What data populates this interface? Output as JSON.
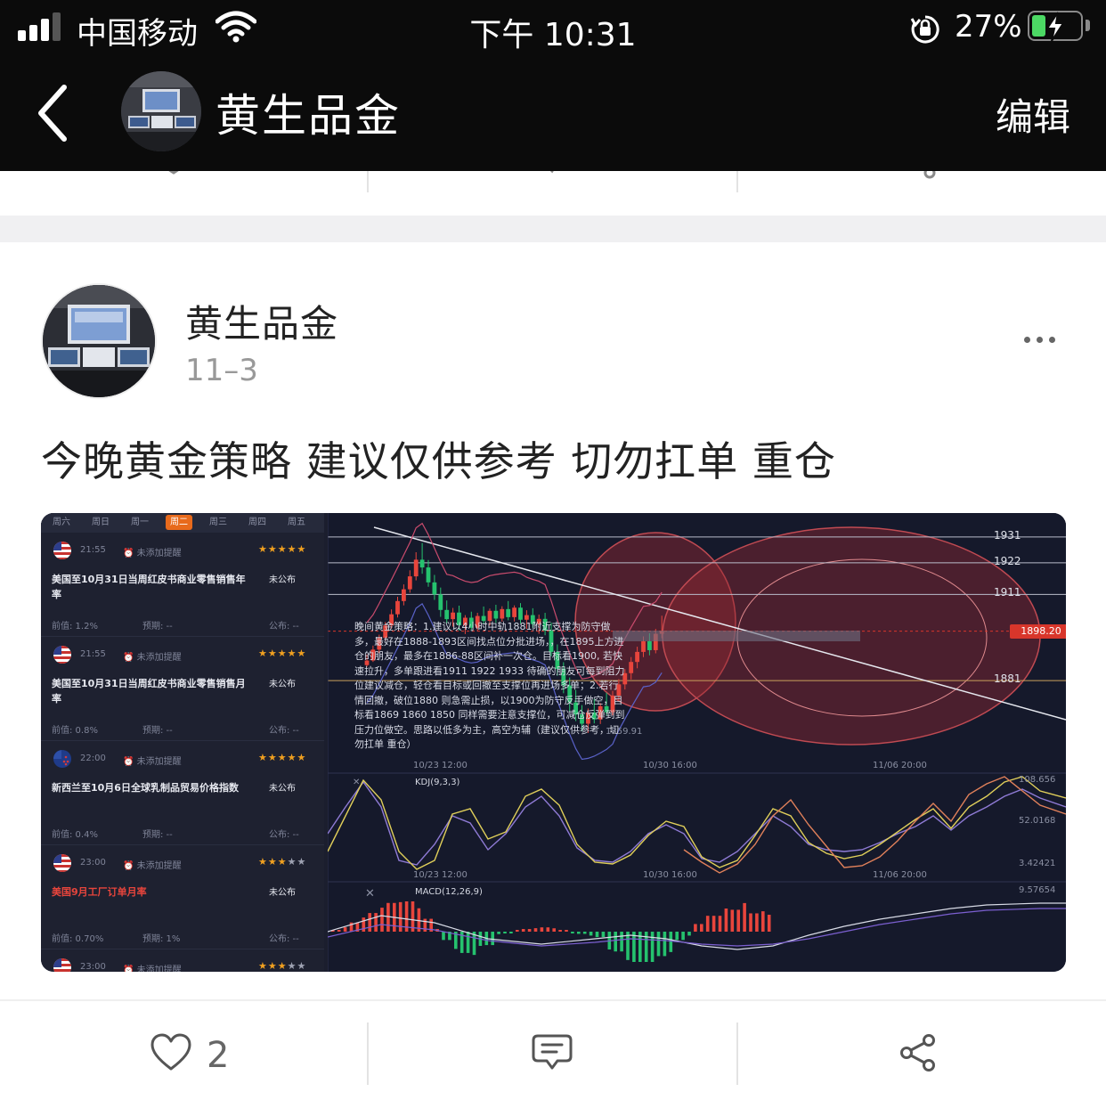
{
  "status_bar": {
    "carrier": "中国移动",
    "time": "下午 10:31",
    "battery_percent": "27%",
    "signal_bars": 3,
    "battery_level": 0.27,
    "battery_color": "#4cd964"
  },
  "navbar": {
    "title": "黄生品金",
    "edit_label": "编辑",
    "back_icon": "chevron-left-icon"
  },
  "post": {
    "author": "黄生品金",
    "date": "11–3",
    "text": "今晚黄金策略 建议仅供参考 切勿扛单 重仓",
    "more_icon": "more-dots-icon"
  },
  "image": {
    "weekday_tabs": [
      "周六",
      "周日",
      "周一",
      "周二",
      "周三",
      "周四",
      "周五"
    ],
    "active_tab": 3,
    "events": [
      {
        "time": "21:55",
        "reminder": "未添加提醒",
        "stars_on": 5,
        "title": "美国至10月31日当周红皮书商业零售销售年率",
        "status": "未公布",
        "prev": "前值: 1.2%",
        "forecast": "预期: --",
        "actual": "公布: --",
        "flag": "us",
        "highlight": false
      },
      {
        "time": "21:55",
        "reminder": "未添加提醒",
        "stars_on": 5,
        "title": "美国至10月31日当周红皮书商业零售销售月率",
        "status": "未公布",
        "prev": "前值: 0.8%",
        "forecast": "预期: --",
        "actual": "公布: --",
        "flag": "us",
        "highlight": false
      },
      {
        "time": "22:00",
        "reminder": "未添加提醒",
        "stars_on": 5,
        "title": "新西兰至10月6日全球乳制品贸易价格指数",
        "status": "未公布",
        "prev": "前值: 0.4%",
        "forecast": "预期: --",
        "actual": "公布: --",
        "flag": "nz",
        "highlight": false
      },
      {
        "time": "23:00",
        "reminder": "未添加提醒",
        "stars_on": 3,
        "title": "美国9月工厂订单月率",
        "status": "未公布",
        "prev": "前值: 0.70%",
        "forecast": "预期: 1%",
        "actual": "公布: --",
        "flag": "us",
        "highlight": true
      },
      {
        "time": "23:00",
        "reminder": "未添加提醒",
        "stars_on": 3,
        "title": "",
        "status": "",
        "prev": "",
        "forecast": "",
        "actual": "",
        "flag": "us",
        "highlight": false
      }
    ],
    "price_levels": [
      "1931",
      "1922",
      "1911",
      "1881"
    ],
    "current_price": "1898.20",
    "strategy_note": "晚间黄金策略：1.建议以4小时中轨1881附近支撑为防守做多，最好在1888-1893区间找点位分批进场，，在1895上方进仓的朋友，最多在1886-88区间补一次仓。目标看1900, 若快速拉升，多单跟进看1911 1922 1933 待确的朋友可每到阻力位建议减仓，轻仓看目标或回撤至支撑位再进场多单；2.若行情回撤，破位1880 则急需止损，以1900为防守反手做空，目标看1869 1860 1850 同样需要注意支撑位，可减仓反弹到到压力位做空。思路以低多为主，高空为辅（建议仅供参考，切勿扛单 重仓）",
    "note_extra": "1859.91",
    "time_axis": [
      "10/23 12:00",
      "10/30 16:00",
      "11/06 20:00"
    ],
    "kdj_label": "KDJ(9,3,3)",
    "kdj_values": [
      "108.656",
      "52.0168",
      "3.42421"
    ],
    "macd_label": "MACD(12,26,9)",
    "macd_value": "9.57654",
    "candle_up_color": "#e8453c",
    "candle_down_color": "#25c26e",
    "candles": [
      [
        1886.4,
        1890.1,
        1885.8,
        1888.0
      ],
      [
        1888.0,
        1893.2,
        1887.5,
        1891.8
      ],
      [
        1891.8,
        1897.0,
        1890.6,
        1895.9
      ],
      [
        1895.9,
        1901.4,
        1894.8,
        1900.2
      ],
      [
        1900.2,
        1905.8,
        1899.1,
        1904.1
      ],
      [
        1904.1,
        1910.2,
        1903.0,
        1908.7
      ],
      [
        1908.7,
        1914.5,
        1907.2,
        1912.8
      ],
      [
        1912.8,
        1919.4,
        1911.6,
        1917.3
      ],
      [
        1917.3,
        1925.7,
        1915.9,
        1923.1
      ],
      [
        1923.1,
        1928.9,
        1918.2,
        1920.4
      ],
      [
        1920.4,
        1923.0,
        1913.7,
        1915.2
      ],
      [
        1915.2,
        1917.8,
        1909.1,
        1911.0
      ],
      [
        1911.0,
        1913.4,
        1903.2,
        1905.6
      ],
      [
        1905.6,
        1908.9,
        1901.0,
        1902.4
      ],
      [
        1902.4,
        1906.3,
        1899.8,
        1904.7
      ],
      [
        1904.7,
        1907.1,
        1898.5,
        1900.3
      ],
      [
        1900.3,
        1903.8,
        1897.2,
        1902.9
      ],
      [
        1902.9,
        1905.0,
        1898.6,
        1899.4
      ],
      [
        1899.4,
        1904.6,
        1898.1,
        1903.5
      ],
      [
        1903.5,
        1906.8,
        1900.7,
        1901.8
      ],
      [
        1901.8,
        1906.1,
        1900.2,
        1905.3
      ],
      [
        1905.3,
        1907.4,
        1901.1,
        1902.6
      ],
      [
        1902.6,
        1906.9,
        1901.5,
        1905.9
      ],
      [
        1905.9,
        1908.7,
        1902.0,
        1903.1
      ],
      [
        1903.1,
        1907.2,
        1901.6,
        1906.4
      ],
      [
        1906.4,
        1908.0,
        1900.9,
        1902.2
      ],
      [
        1902.2,
        1905.5,
        1899.0,
        1903.8
      ],
      [
        1903.8,
        1906.2,
        1899.4,
        1900.7
      ],
      [
        1900.7,
        1904.0,
        1897.3,
        1902.5
      ],
      [
        1902.5,
        1904.6,
        1896.8,
        1898.4
      ],
      [
        1898.4,
        1901.2,
        1889.5,
        1891.0
      ],
      [
        1891.0,
        1893.6,
        1882.7,
        1885.1
      ],
      [
        1885.1,
        1887.4,
        1876.6,
        1879.3
      ],
      [
        1879.3,
        1882.1,
        1870.2,
        1873.4
      ],
      [
        1873.4,
        1877.8,
        1866.9,
        1869.2
      ],
      [
        1869.2,
        1872.5,
        1863.4,
        1866.0
      ],
      [
        1866.0,
        1871.3,
        1862.8,
        1869.9
      ],
      [
        1869.9,
        1874.6,
        1866.1,
        1867.5
      ],
      [
        1867.5,
        1873.2,
        1865.9,
        1872.1
      ],
      [
        1872.1,
        1876.8,
        1868.7,
        1870.0
      ],
      [
        1870.0,
        1877.4,
        1868.9,
        1875.8
      ],
      [
        1875.8,
        1881.5,
        1873.6,
        1879.7
      ],
      [
        1879.7,
        1885.0,
        1877.9,
        1883.6
      ],
      [
        1883.6,
        1889.2,
        1881.4,
        1887.5
      ],
      [
        1887.5,
        1892.8,
        1885.3,
        1891.0
      ],
      [
        1891.0,
        1896.4,
        1889.2,
        1894.7
      ],
      [
        1894.7,
        1897.5,
        1889.8,
        1891.6
      ],
      [
        1891.6,
        1899.0,
        1890.5,
        1897.3
      ],
      [
        1897.3,
        1903.6,
        1895.8,
        1898.2
      ]
    ],
    "price_range": [
      1855,
      1935
    ]
  },
  "actions": {
    "like_count": "2",
    "like_icon": "heart-icon",
    "comment_icon": "comment-icon",
    "share_icon": "share-icon"
  }
}
